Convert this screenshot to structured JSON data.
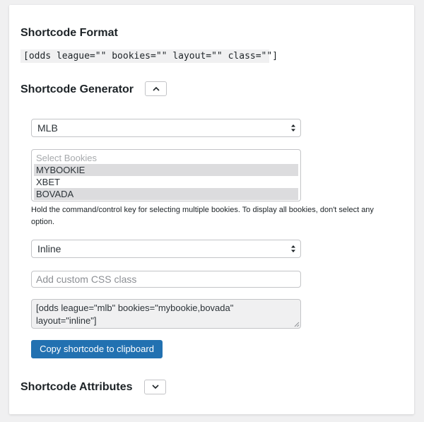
{
  "format": {
    "title": "Shortcode Format",
    "code": "[odds league=\"\" bookies=\"\" layout=\"\" class=\"\"]"
  },
  "generator": {
    "title": "Shortcode Generator",
    "league_select": {
      "selected": "MLB"
    },
    "bookies": {
      "placeholder": "Select Bookies",
      "options": [
        {
          "label": "MYBOOKIE",
          "selected": true
        },
        {
          "label": "XBET",
          "selected": false
        },
        {
          "label": "BOVADA",
          "selected": true
        }
      ],
      "help": "Hold the command/control key for selecting multiple bookies. To display all bookies, don't select any option."
    },
    "layout_select": {
      "selected": "Inline"
    },
    "css_class": {
      "value": "",
      "placeholder": "Add custom CSS class"
    },
    "output": "[odds league=\"mlb\" bookies=\"mybookie,bovada\" layout=\"inline\"]",
    "copy_label": "Copy shortcode to clipboard"
  },
  "attributes": {
    "title": "Shortcode Attributes"
  },
  "colors": {
    "primary_button": "#2271b1",
    "selected_option": "#dcdcde",
    "border": "#c3c4c7"
  },
  "icons": {
    "gen_toggle": "chevron-up-icon",
    "attr_toggle": "chevron-down-icon",
    "select_arrows": "select-arrows-icon"
  }
}
